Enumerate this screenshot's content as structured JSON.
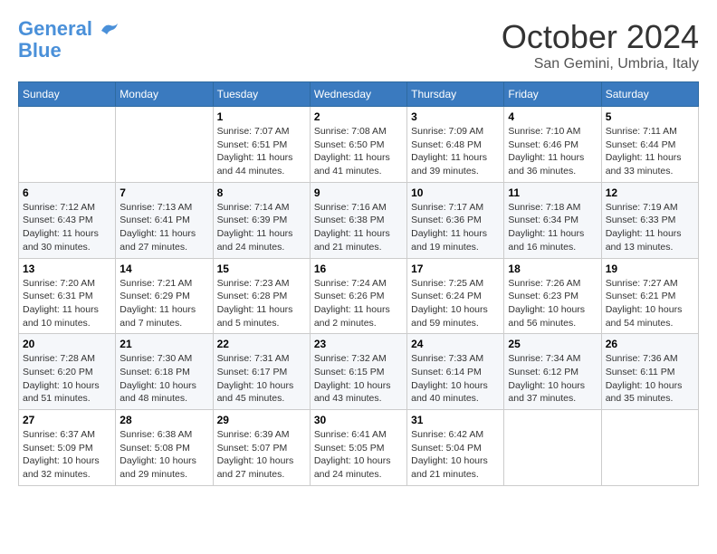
{
  "logo": {
    "line1": "General",
    "line2": "Blue"
  },
  "title": "October 2024",
  "subtitle": "San Gemini, Umbria, Italy",
  "days_of_week": [
    "Sunday",
    "Monday",
    "Tuesday",
    "Wednesday",
    "Thursday",
    "Friday",
    "Saturday"
  ],
  "weeks": [
    [
      {
        "day": "",
        "info": ""
      },
      {
        "day": "",
        "info": ""
      },
      {
        "day": "1",
        "info": "Sunrise: 7:07 AM\nSunset: 6:51 PM\nDaylight: 11 hours and 44 minutes."
      },
      {
        "day": "2",
        "info": "Sunrise: 7:08 AM\nSunset: 6:50 PM\nDaylight: 11 hours and 41 minutes."
      },
      {
        "day": "3",
        "info": "Sunrise: 7:09 AM\nSunset: 6:48 PM\nDaylight: 11 hours and 39 minutes."
      },
      {
        "day": "4",
        "info": "Sunrise: 7:10 AM\nSunset: 6:46 PM\nDaylight: 11 hours and 36 minutes."
      },
      {
        "day": "5",
        "info": "Sunrise: 7:11 AM\nSunset: 6:44 PM\nDaylight: 11 hours and 33 minutes."
      }
    ],
    [
      {
        "day": "6",
        "info": "Sunrise: 7:12 AM\nSunset: 6:43 PM\nDaylight: 11 hours and 30 minutes."
      },
      {
        "day": "7",
        "info": "Sunrise: 7:13 AM\nSunset: 6:41 PM\nDaylight: 11 hours and 27 minutes."
      },
      {
        "day": "8",
        "info": "Sunrise: 7:14 AM\nSunset: 6:39 PM\nDaylight: 11 hours and 24 minutes."
      },
      {
        "day": "9",
        "info": "Sunrise: 7:16 AM\nSunset: 6:38 PM\nDaylight: 11 hours and 21 minutes."
      },
      {
        "day": "10",
        "info": "Sunrise: 7:17 AM\nSunset: 6:36 PM\nDaylight: 11 hours and 19 minutes."
      },
      {
        "day": "11",
        "info": "Sunrise: 7:18 AM\nSunset: 6:34 PM\nDaylight: 11 hours and 16 minutes."
      },
      {
        "day": "12",
        "info": "Sunrise: 7:19 AM\nSunset: 6:33 PM\nDaylight: 11 hours and 13 minutes."
      }
    ],
    [
      {
        "day": "13",
        "info": "Sunrise: 7:20 AM\nSunset: 6:31 PM\nDaylight: 11 hours and 10 minutes."
      },
      {
        "day": "14",
        "info": "Sunrise: 7:21 AM\nSunset: 6:29 PM\nDaylight: 11 hours and 7 minutes."
      },
      {
        "day": "15",
        "info": "Sunrise: 7:23 AM\nSunset: 6:28 PM\nDaylight: 11 hours and 5 minutes."
      },
      {
        "day": "16",
        "info": "Sunrise: 7:24 AM\nSunset: 6:26 PM\nDaylight: 11 hours and 2 minutes."
      },
      {
        "day": "17",
        "info": "Sunrise: 7:25 AM\nSunset: 6:24 PM\nDaylight: 10 hours and 59 minutes."
      },
      {
        "day": "18",
        "info": "Sunrise: 7:26 AM\nSunset: 6:23 PM\nDaylight: 10 hours and 56 minutes."
      },
      {
        "day": "19",
        "info": "Sunrise: 7:27 AM\nSunset: 6:21 PM\nDaylight: 10 hours and 54 minutes."
      }
    ],
    [
      {
        "day": "20",
        "info": "Sunrise: 7:28 AM\nSunset: 6:20 PM\nDaylight: 10 hours and 51 minutes."
      },
      {
        "day": "21",
        "info": "Sunrise: 7:30 AM\nSunset: 6:18 PM\nDaylight: 10 hours and 48 minutes."
      },
      {
        "day": "22",
        "info": "Sunrise: 7:31 AM\nSunset: 6:17 PM\nDaylight: 10 hours and 45 minutes."
      },
      {
        "day": "23",
        "info": "Sunrise: 7:32 AM\nSunset: 6:15 PM\nDaylight: 10 hours and 43 minutes."
      },
      {
        "day": "24",
        "info": "Sunrise: 7:33 AM\nSunset: 6:14 PM\nDaylight: 10 hours and 40 minutes."
      },
      {
        "day": "25",
        "info": "Sunrise: 7:34 AM\nSunset: 6:12 PM\nDaylight: 10 hours and 37 minutes."
      },
      {
        "day": "26",
        "info": "Sunrise: 7:36 AM\nSunset: 6:11 PM\nDaylight: 10 hours and 35 minutes."
      }
    ],
    [
      {
        "day": "27",
        "info": "Sunrise: 6:37 AM\nSunset: 5:09 PM\nDaylight: 10 hours and 32 minutes."
      },
      {
        "day": "28",
        "info": "Sunrise: 6:38 AM\nSunset: 5:08 PM\nDaylight: 10 hours and 29 minutes."
      },
      {
        "day": "29",
        "info": "Sunrise: 6:39 AM\nSunset: 5:07 PM\nDaylight: 10 hours and 27 minutes."
      },
      {
        "day": "30",
        "info": "Sunrise: 6:41 AM\nSunset: 5:05 PM\nDaylight: 10 hours and 24 minutes."
      },
      {
        "day": "31",
        "info": "Sunrise: 6:42 AM\nSunset: 5:04 PM\nDaylight: 10 hours and 21 minutes."
      },
      {
        "day": "",
        "info": ""
      },
      {
        "day": "",
        "info": ""
      }
    ]
  ]
}
